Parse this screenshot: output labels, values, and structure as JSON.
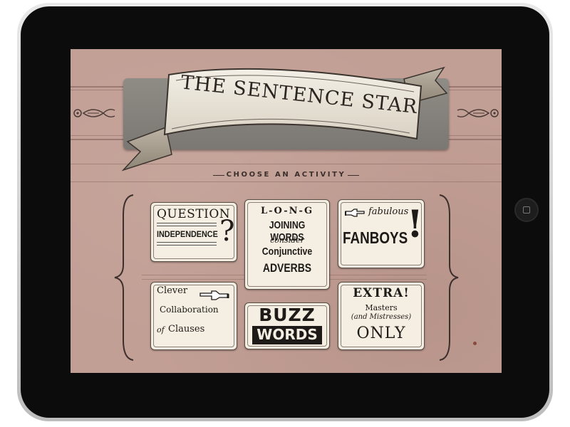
{
  "app": {
    "title": "THE SENTENCE STAR",
    "subtitle": "CHOOSE AN ACTIVITY"
  },
  "activities": {
    "question_independence": {
      "line1": "QUESTION",
      "line2": "INDEPENDENCE",
      "mark": "?"
    },
    "long_joining_words": {
      "line1": "L-O-N-G",
      "line2": "JOINING WORDS",
      "line3": "consider",
      "line4": "Conjunctive",
      "line5": "ADVERBS"
    },
    "fabulous_fanboys": {
      "line1": "fabulous",
      "line2": "FANBOYS",
      "mark": "!"
    },
    "clever_collaboration": {
      "line1": "Clever",
      "line2": "Collaboration",
      "line3": "of",
      "line4": "Clauses"
    },
    "buzz_words": {
      "line1": "BUZZ",
      "line2": "WORDS"
    },
    "extra_masters": {
      "line1": "EXTRA!",
      "line2": "Masters",
      "line3": "(and Mistresses)",
      "line4": "ONLY"
    }
  },
  "icons": [
    "pointing-hand-icon",
    "ornament-icon",
    "home-button-icon"
  ],
  "colors": {
    "screen": "#c29f95",
    "card": "#f4efe2",
    "ink": "#1e1a17",
    "bezel": "#0c0c0c"
  }
}
